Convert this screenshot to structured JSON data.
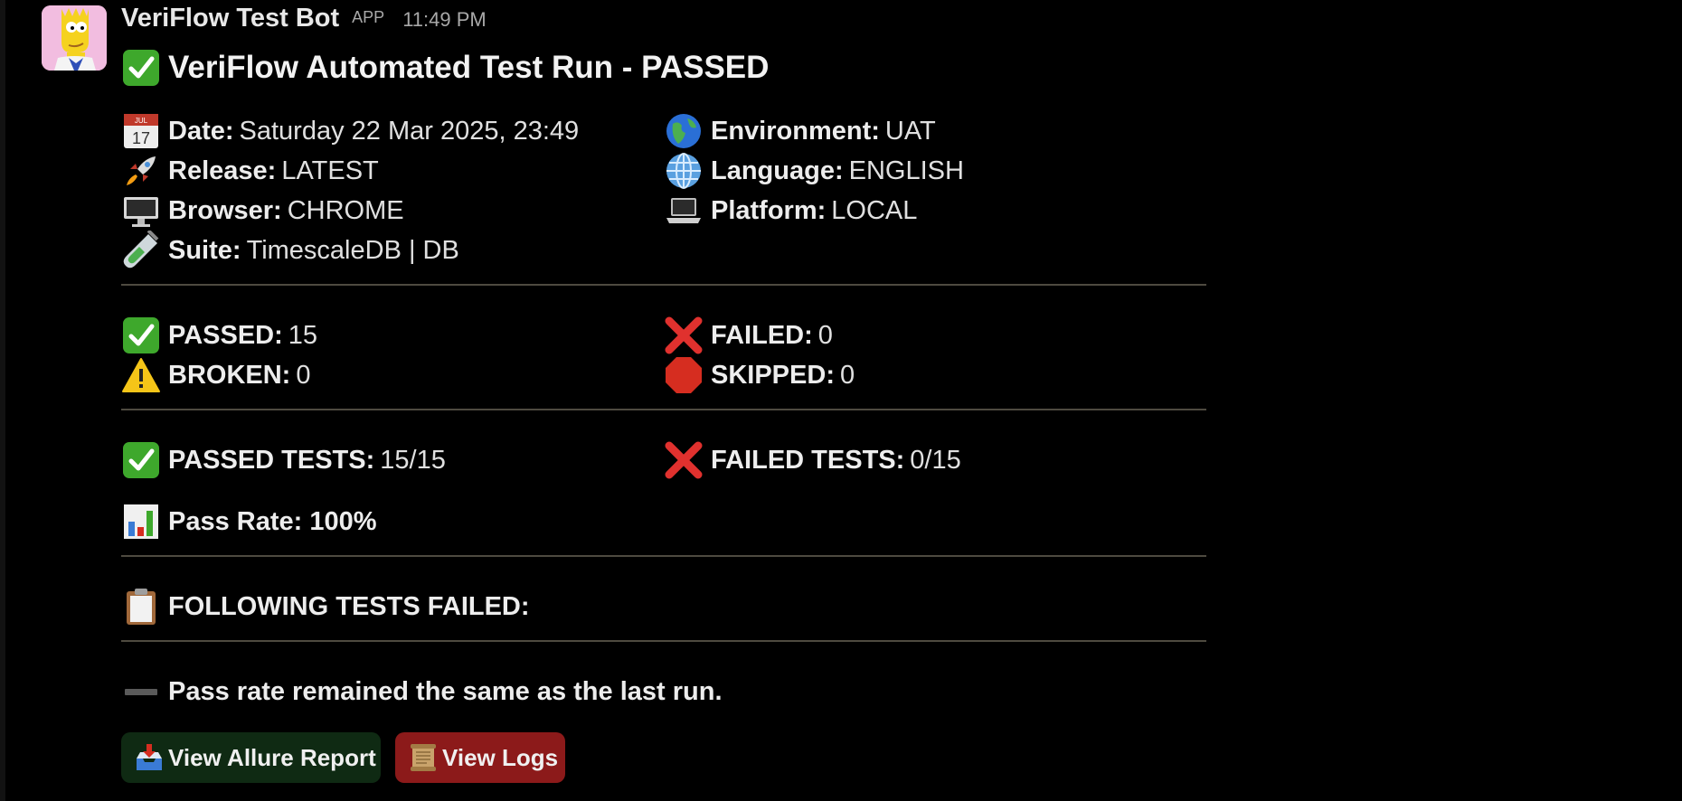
{
  "message": {
    "bot_name": "VeriFlow Test Bot",
    "app_badge": "APP",
    "timestamp": "11:49 PM",
    "title": "VeriFlow Automated Test Run - PASSED",
    "title_icon": "check-mark-icon"
  },
  "details": {
    "date": {
      "icon": "calendar-icon",
      "label": "Date:",
      "value": "Saturday 22 Mar 2025, 23:49"
    },
    "environment": {
      "icon": "globe-icon",
      "label": "Environment:",
      "value": "UAT"
    },
    "release": {
      "icon": "rocket-icon",
      "label": "Release:",
      "value": "LATEST"
    },
    "language": {
      "icon": "globe-meridians-icon",
      "label": "Language:",
      "value": "ENGLISH"
    },
    "browser": {
      "icon": "desktop-computer-icon",
      "label": "Browser:",
      "value": "CHROME"
    },
    "platform": {
      "icon": "laptop-icon",
      "label": "Platform:",
      "value": "LOCAL"
    },
    "suite": {
      "icon": "test-tube-icon",
      "label": "Suite:",
      "value": "TimescaleDB | DB"
    }
  },
  "stats": {
    "passed": {
      "icon": "check-mark-icon",
      "label": "PASSED:",
      "value": "15"
    },
    "failed": {
      "icon": "cross-mark-icon",
      "label": "FAILED:",
      "value": "0"
    },
    "broken": {
      "icon": "warning-icon",
      "label": "BROKEN:",
      "value": "0"
    },
    "skipped": {
      "icon": "stop-sign-icon",
      "label": "SKIPPED:",
      "value": "0"
    }
  },
  "totals": {
    "passed_tests": {
      "icon": "check-mark-icon",
      "label": "PASSED TESTS:",
      "value": "15/15"
    },
    "failed_tests": {
      "icon": "cross-mark-icon",
      "label": "FAILED TESTS:",
      "value": "0/15"
    },
    "pass_rate": {
      "icon": "bar-chart-icon",
      "label": "Pass Rate: 100%"
    }
  },
  "failed_section": {
    "icon": "clipboard-icon",
    "label": "FOLLOWING TESTS FAILED:"
  },
  "trend": {
    "icon": "minus-icon",
    "text": "Pass rate remained the same as the last run."
  },
  "buttons": {
    "allure": {
      "icon": "inbox-tray-icon",
      "label": "View Allure Report"
    },
    "logs": {
      "icon": "scroll-icon",
      "label": "View Logs"
    }
  },
  "colors": {
    "background": "#000000",
    "check_green": "#3ea82c",
    "cross_red": "#e0312e",
    "allure_button": "#0f2a13",
    "logs_button": "#8c1a1a",
    "divider": "#4e4a40"
  }
}
